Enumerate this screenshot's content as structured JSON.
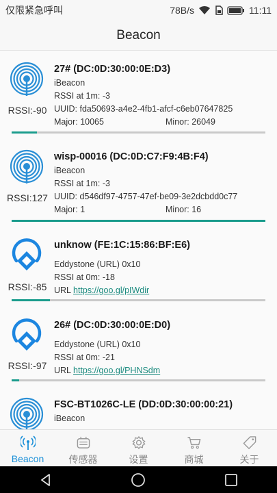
{
  "status_bar": {
    "carrier": "仅限紧急呼叫",
    "speed": "78B/s",
    "time": "11:11"
  },
  "app_bar": {
    "title": "Beacon"
  },
  "beacons": [
    {
      "icon": "ibeacon-icon",
      "title": "27# (DC:0D:30:00:0E:D3)",
      "type": "iBeacon",
      "rssi_1m": "RSSI at 1m: -3",
      "uuid": "UUID: fda50693-a4e2-4fb1-afcf-c6eb07647825",
      "major": "Major: 10065",
      "minor": "Minor: 26049",
      "rssi": "RSSI:-90",
      "signal_fraction": 0.1
    },
    {
      "icon": "ibeacon-icon",
      "title": "wisp-00016 (DC:0D:C7:F9:4B:F4)",
      "type": "iBeacon",
      "rssi_1m": "RSSI at 1m: -3",
      "uuid": "UUID: d546df97-4757-47ef-be09-3e2dcbdd0c77",
      "major": "Major: 1",
      "minor": "Minor: 16",
      "rssi": "RSSI:127",
      "signal_fraction": 1.0
    },
    {
      "icon": "eddystone-icon",
      "title": "unknow (FE:1C:15:86:BF:E6)",
      "type": "Eddystone (URL) 0x10",
      "rssi_0m": "RSSI at 0m: -18",
      "url_label": "URL",
      "url": "https://goo.gl/pIWdir",
      "rssi": "RSSI:-85",
      "signal_fraction": 0.15
    },
    {
      "icon": "eddystone-icon",
      "title": "26# (DC:0D:30:00:0E:D0)",
      "type": "Eddystone (URL) 0x10",
      "rssi_0m": "RSSI at 0m: -21",
      "url_label": "URL",
      "url": "https://goo.gl/PHNSdm",
      "rssi": "RSSI:-97",
      "signal_fraction": 0.03
    },
    {
      "icon": "ibeacon-icon",
      "title": "FSC-BT1026C-LE (DD:0D:30:00:00:21)",
      "type": "iBeacon"
    }
  ],
  "bottom_nav": [
    {
      "label": "Beacon",
      "icon": "beacon-tab-icon",
      "active": true
    },
    {
      "label": "传感器",
      "icon": "sensor-icon",
      "active": false
    },
    {
      "label": "设置",
      "icon": "settings-gear-icon",
      "active": false
    },
    {
      "label": "商城",
      "icon": "shopping-cart-icon",
      "active": false
    },
    {
      "label": "关于",
      "icon": "tag-icon",
      "active": false
    }
  ],
  "colors": {
    "accent": "#1a9c8c",
    "nav_active": "#1a8fd8",
    "ibeacon_blue": "#2a8fd6",
    "eddystone_blue": "#1c86e0"
  }
}
